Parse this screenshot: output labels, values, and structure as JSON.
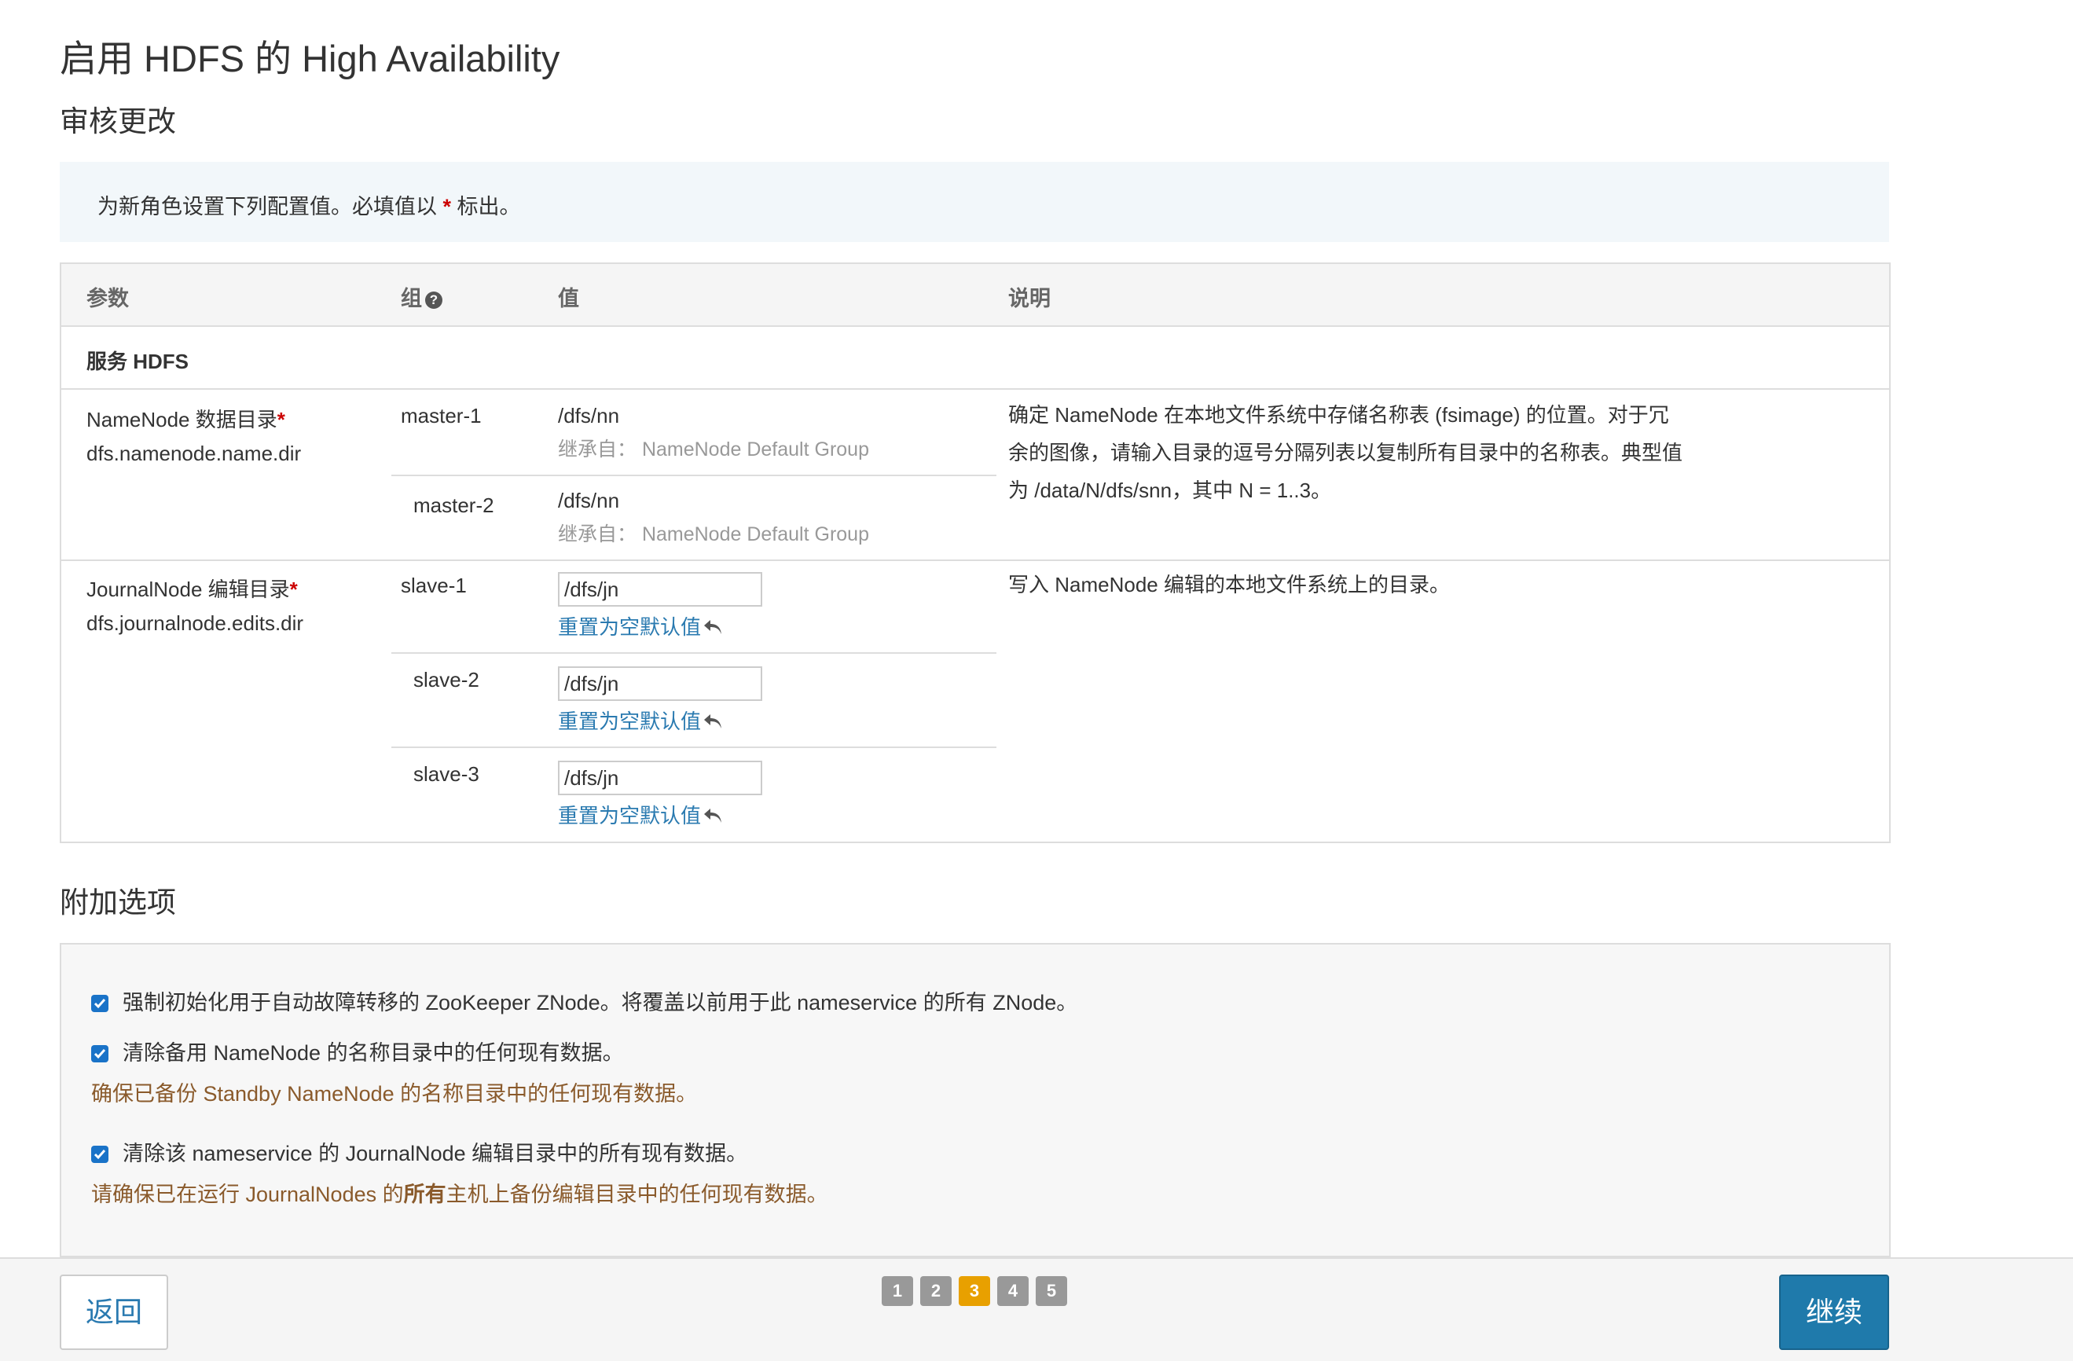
{
  "page": {
    "title": "启用 HDFS 的 High Availability",
    "subtitle": "审核更改"
  },
  "info": {
    "text_before": "为新角色设置下列配置值。必填值以 ",
    "star": "*",
    "text_after": " 标出。"
  },
  "table": {
    "headers": {
      "param": "参数",
      "group": "组",
      "value": "值",
      "description": "说明"
    },
    "section": "服务 HDFS",
    "rows": [
      {
        "param_name": "NameNode 数据目录",
        "required_mark": "*",
        "param_key": "dfs.namenode.name.dir",
        "description": "确定 NameNode 在本地文件系统中存储名称表 (fsimage) 的位置。对于冗余的图像，请输入目录的逗号分隔列表以复制所有目录中的名称表。典型值为 /data/N/dfs/snn，其中 N = 1..3。",
        "groups": [
          {
            "name": "master-1",
            "value": "/dfs/nn",
            "inherit": "继承自：  NameNode Default Group"
          },
          {
            "name": "master-2",
            "value": "/dfs/nn",
            "inherit": "继承自：  NameNode Default Group"
          }
        ]
      },
      {
        "param_name": "JournalNode 编辑目录",
        "required_mark": "*",
        "param_key": "dfs.journalnode.edits.dir",
        "description": "写入 NameNode 编辑的本地文件系统上的目录。",
        "groups": [
          {
            "name": "slave-1",
            "value": "/dfs/jn",
            "reset": "重置为空默认值"
          },
          {
            "name": "slave-2",
            "value": "/dfs/jn",
            "reset": "重置为空默认值"
          },
          {
            "name": "slave-3",
            "value": "/dfs/jn",
            "reset": "重置为空默认值"
          }
        ]
      }
    ]
  },
  "additional": {
    "title": "附加选项",
    "options": [
      {
        "label": "强制初始化用于自动故障转移的 ZooKeeper ZNode。将覆盖以前用于此 nameservice 的所有 ZNode。",
        "checked": true
      },
      {
        "label": "清除备用 NameNode 的名称目录中的任何现有数据。",
        "checked": true,
        "warning": "确保已备份 Standby NameNode 的名称目录中的任何现有数据。"
      },
      {
        "label": "清除该 nameservice 的 JournalNode 编辑目录中的所有现有数据。",
        "checked": true,
        "warning_before": "请确保已在运行 JournalNodes 的",
        "warning_bold": "所有",
        "warning_after": "主机上备份编辑目录中的任何现有数据。"
      }
    ]
  },
  "footer": {
    "back_label": "返回",
    "next_label": "继续",
    "steps": [
      "1",
      "2",
      "3",
      "4",
      "5"
    ],
    "active_step": "3"
  },
  "colors": {
    "primary_button": "#1f7aab",
    "link": "#2a7ab0",
    "active_step": "#e8a000",
    "warning_text": "#8a5a2b",
    "checkbox": "#1a73c8"
  }
}
